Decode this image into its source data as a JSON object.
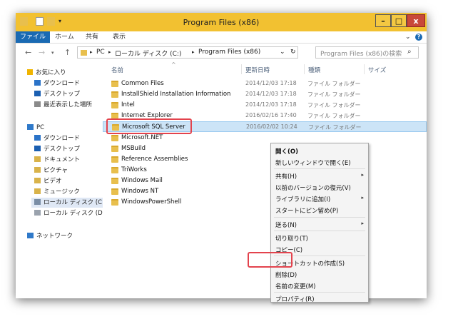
{
  "window": {
    "title": "Program Files (x86)",
    "controls": {
      "minimize": "–",
      "maximize": "□",
      "close": "x"
    }
  },
  "ribbon": {
    "tabs": [
      "ファイル",
      "ホーム",
      "共有",
      "表示"
    ],
    "collapse_glyph": "⌄",
    "help_glyph": "?"
  },
  "address": {
    "back": "←",
    "forward": "→",
    "up": "↑",
    "path": [
      "PC",
      "ローカル ディスク (C:)",
      "Program Files (x86)"
    ],
    "separator": "▸",
    "dropdown_glyph": "⌄",
    "refresh_glyph": "↻",
    "search_placeholder": "Program Files (x86)の検索",
    "search_glyph": "⌕"
  },
  "nav": {
    "favorites": "お気に入り",
    "fav_items": [
      "ダウンロード",
      "デスクトップ",
      "最近表示した場所"
    ],
    "pc": "PC",
    "pc_items": [
      "ダウンロード",
      "デスクトップ",
      "ドキュメント",
      "ピクチャ",
      "ビデオ",
      "ミュージック",
      "ローカル ディスク (C:)",
      "ローカル ディスク (D:)"
    ],
    "network": "ネットワーク"
  },
  "columns": {
    "name": "名前",
    "date": "更新日時",
    "type": "種類",
    "size": "サイズ",
    "sort_glyph": "^"
  },
  "files": [
    {
      "name": "Common Files",
      "date": "2014/12/03 17:18",
      "type": "ファイル フォルダー"
    },
    {
      "name": "InstallShield Installation Information",
      "date": "2014/12/03 17:18",
      "type": "ファイル フォルダー"
    },
    {
      "name": "Intel",
      "date": "2014/12/03 17:18",
      "type": "ファイル フォルダー"
    },
    {
      "name": "Internet Explorer",
      "date": "2016/02/16 17:40",
      "type": "ファイル フォルダー"
    },
    {
      "name": "Microsoft SQL Server",
      "date": "2016/02/02 10:24",
      "type": "ファイル フォルダー"
    },
    {
      "name": "Microsoft.NET",
      "date": "",
      "type": ""
    },
    {
      "name": "MSBuild",
      "date": "",
      "type": ""
    },
    {
      "name": "Reference Assemblies",
      "date": "",
      "type": ""
    },
    {
      "name": "TriWorks",
      "date": "",
      "type": ""
    },
    {
      "name": "Windows Mail",
      "date": "",
      "type": ""
    },
    {
      "name": "Windows NT",
      "date": "",
      "type": ""
    },
    {
      "name": "WindowsPowerShell",
      "date": "",
      "type": ""
    }
  ],
  "context_menu": [
    {
      "label": "開く(O)",
      "bold": true
    },
    {
      "label": "新しいウィンドウで開く(E)"
    },
    {
      "label": "共有(H)",
      "arrow": "▸"
    },
    {
      "label": "以前のバージョンの復元(V)"
    },
    {
      "label": "ライブラリに追加(I)",
      "arrow": "▸"
    },
    {
      "label": "スタートにピン留め(P)"
    },
    {
      "label": "送る(N)",
      "arrow": "▸"
    },
    {
      "label": "切り取り(T)"
    },
    {
      "label": "コピー(C)"
    },
    {
      "label": "ショートカットの作成(S)"
    },
    {
      "label": "削除(D)"
    },
    {
      "label": "名前の変更(M)"
    },
    {
      "label": "プロパティ(R)"
    }
  ],
  "colors": {
    "title_bar": "#f2c131",
    "file_tab": "#1a6ab3",
    "selection": "#cce4f7",
    "highlight_box": "#e3434d",
    "folder": "#e8bf4d"
  }
}
